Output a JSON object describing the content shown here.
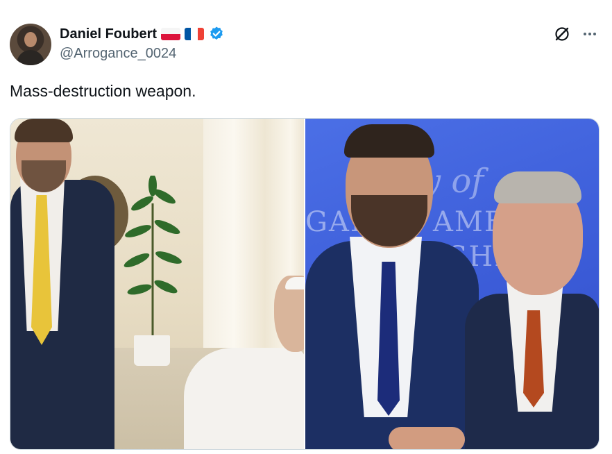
{
  "tweet": {
    "author": {
      "display_name": "Daniel Foubert",
      "handle": "@Arrogance_0024",
      "flags": [
        "poland-flag",
        "france-flag"
      ],
      "verified_icon": "verified-badge-icon"
    },
    "text": "Mass-destruction weapon.",
    "actions": {
      "grok_icon": "grok-icon",
      "more_icon": "more-icon"
    },
    "media": {
      "banner_words": [
        "GAI",
        "AME",
        "SHIP"
      ]
    }
  },
  "colors": {
    "accent_blue": "#1d9bf0",
    "text_primary": "#0f1419",
    "text_secondary": "#536471",
    "poland_red": "#dc143c",
    "france_blue": "#0055a4",
    "france_red": "#ef4135"
  }
}
